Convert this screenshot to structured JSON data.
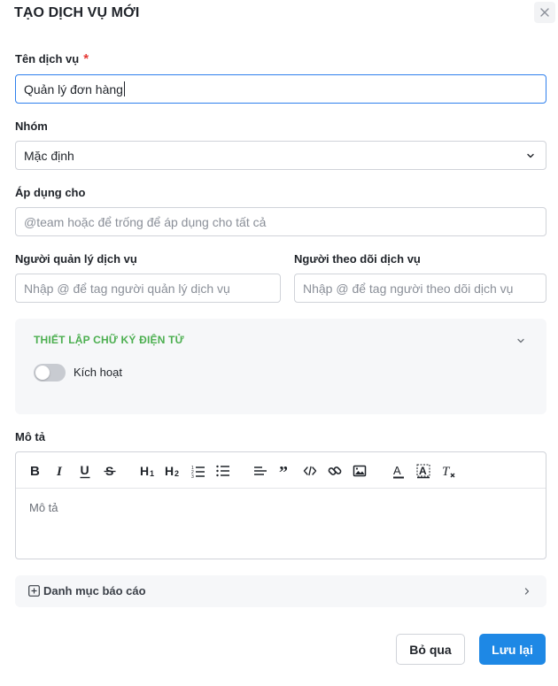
{
  "modal": {
    "title": "TẠO DỊCH VỤ MỚI"
  },
  "service_name": {
    "label": "Tên dịch vụ",
    "required_mark": "*",
    "value": "Quản lý đơn hàng"
  },
  "group": {
    "label": "Nhóm",
    "selected": "Mặc định"
  },
  "apply_to": {
    "label": "Áp dụng cho",
    "placeholder": "@team hoặc để trống để áp dụng cho tất cả"
  },
  "managers": {
    "label": "Người quản lý dịch vụ",
    "placeholder": "Nhập @ để tag người quản lý dịch vụ"
  },
  "followers": {
    "label": "Người theo dõi dịch vụ",
    "placeholder": "Nhập @ để tag người theo dõi dịch vụ"
  },
  "esign": {
    "title": "THIẾT LẬP CHỮ KÝ ĐIỆN TỬ",
    "toggle_label": "Kích hoạt",
    "enabled": false
  },
  "description": {
    "label": "Mô tả",
    "placeholder": "Mô tả",
    "toolbar": [
      "bold",
      "italic",
      "underline",
      "strikethrough",
      "heading-1",
      "heading-2",
      "ordered-list",
      "bullet-list",
      "align",
      "quote",
      "code",
      "link",
      "image",
      "text-color",
      "highlight",
      "clear-format"
    ]
  },
  "report_category": {
    "label": "Danh mục báo cáo"
  },
  "actions": {
    "cancel": "Bỏ qua",
    "save": "Lưu lại"
  },
  "colors": {
    "accent": "#1e88e5",
    "esign_title": "#4caf50",
    "required": "#e53935",
    "focus_border": "#2f80ed"
  }
}
